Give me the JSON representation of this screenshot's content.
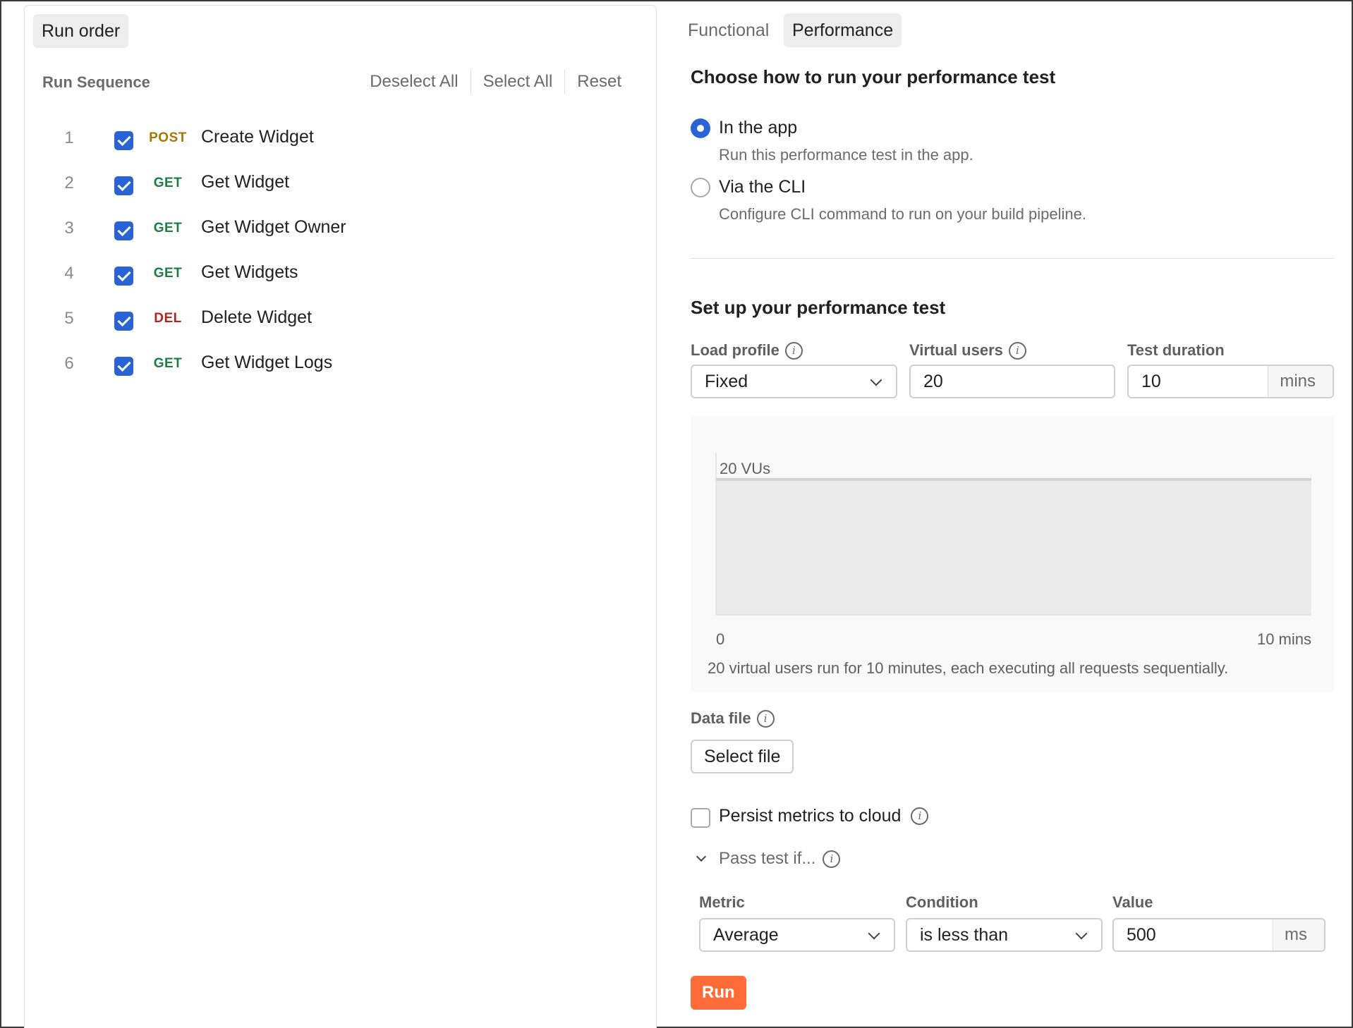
{
  "left_panel": {
    "run_order_label": "Run order",
    "sequence_title": "Run Sequence",
    "actions": {
      "deselect_all": "Deselect All",
      "select_all": "Select All",
      "reset": "Reset"
    },
    "requests": [
      {
        "index": "1",
        "method": "POST",
        "name": "Create Widget",
        "checked": true
      },
      {
        "index": "2",
        "method": "GET",
        "name": "Get Widget",
        "checked": true
      },
      {
        "index": "3",
        "method": "GET",
        "name": "Get Widget Owner",
        "checked": true
      },
      {
        "index": "4",
        "method": "GET",
        "name": "Get Widgets",
        "checked": true
      },
      {
        "index": "5",
        "method": "DEL",
        "name": "Delete Widget",
        "checked": true
      },
      {
        "index": "6",
        "method": "GET",
        "name": "Get Widget Logs",
        "checked": true
      }
    ]
  },
  "tabs": {
    "functional": "Functional",
    "performance": "Performance",
    "active": "Performance"
  },
  "run_mode": {
    "heading": "Choose how to run your performance test",
    "options": [
      {
        "label": "In the app",
        "description": "Run this performance test in the app.",
        "selected": true
      },
      {
        "label": "Via the CLI",
        "description": "Configure CLI command to run on your build pipeline.",
        "selected": false
      }
    ]
  },
  "setup": {
    "heading": "Set up your performance test",
    "load_profile": {
      "label": "Load profile",
      "value": "Fixed"
    },
    "virtual_users": {
      "label": "Virtual users",
      "value": "20"
    },
    "test_duration": {
      "label": "Test duration",
      "value": "10",
      "unit": "mins"
    },
    "chart": {
      "vu_label": "20 VUs",
      "x_start": "0",
      "x_end": "10 mins",
      "caption": "20 virtual users run for 10 minutes, each executing all requests sequentially."
    },
    "data_file": {
      "label": "Data file",
      "button": "Select file"
    },
    "persist_metrics": {
      "label": "Persist metrics to cloud",
      "checked": false
    },
    "pass_test": {
      "toggle_label": "Pass test if...",
      "metric": {
        "label": "Metric",
        "value": "Average"
      },
      "condition": {
        "label": "Condition",
        "value": "is less than"
      },
      "value": {
        "label": "Value",
        "value": "500",
        "unit": "ms"
      }
    },
    "run_button": "Run"
  },
  "colors": {
    "accent": "#2a63d4",
    "run_button": "#ff6c37",
    "post": "#a77800",
    "get": "#1a7f42",
    "del": "#b3261e"
  },
  "icons": [
    "check-icon",
    "info-icon",
    "chevron-down-icon"
  ],
  "chart_data": {
    "type": "area",
    "x": [
      0,
      10
    ],
    "series": [
      {
        "values": [
          20,
          20
        ]
      }
    ],
    "xlabel": "",
    "ylabel": "",
    "x_tick_labels": [
      "0",
      "10 mins"
    ],
    "annotations": [
      "20 VUs"
    ],
    "ylim": [
      0,
      20
    ],
    "grid": false
  }
}
